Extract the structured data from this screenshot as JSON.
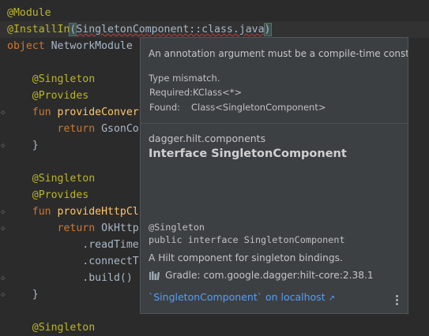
{
  "editor": {
    "lines": [
      {
        "segments": [
          {
            "text": "@Module",
            "cls": "ann"
          }
        ]
      },
      {
        "highlight": true,
        "segments": [
          {
            "text": "@InstallIn",
            "cls": "ann"
          },
          {
            "text": "(",
            "cls": "plain paren-match"
          },
          {
            "text": "SingletonComponent::class.java",
            "cls": "plain squiggle"
          },
          {
            "text": ")",
            "cls": "plain paren-match"
          }
        ]
      },
      {
        "segments": [
          {
            "text": "object ",
            "cls": "kw"
          },
          {
            "text": "NetworkModule",
            "cls": "plain"
          }
        ]
      },
      {
        "segments": []
      },
      {
        "segments": [
          {
            "text": "    @Singleton",
            "cls": "ann"
          }
        ]
      },
      {
        "segments": [
          {
            "text": "    @Provides",
            "cls": "ann"
          }
        ]
      },
      {
        "gutter": "fun",
        "segments": [
          {
            "text": "    fun ",
            "cls": "kw"
          },
          {
            "text": "provideConver",
            "cls": "fn"
          }
        ]
      },
      {
        "segments": [
          {
            "text": "        return ",
            "cls": "kw"
          },
          {
            "text": "GsonCo",
            "cls": "plain"
          }
        ]
      },
      {
        "gutter": "end",
        "segments": [
          {
            "text": "    }",
            "cls": "plain"
          }
        ]
      },
      {
        "segments": []
      },
      {
        "segments": [
          {
            "text": "    @Singleton",
            "cls": "ann"
          }
        ]
      },
      {
        "segments": [
          {
            "text": "    @Provides",
            "cls": "ann"
          }
        ]
      },
      {
        "gutter": "fun",
        "segments": [
          {
            "text": "    fun ",
            "cls": "kw"
          },
          {
            "text": "provideHttpCl",
            "cls": "fn"
          }
        ]
      },
      {
        "gutter": "fun",
        "segments": [
          {
            "text": "        return ",
            "cls": "kw"
          },
          {
            "text": "OkHttp",
            "cls": "plain"
          }
        ]
      },
      {
        "segments": [
          {
            "text": "            .readTime",
            "cls": "plain"
          }
        ]
      },
      {
        "segments": [
          {
            "text": "            .connectT",
            "cls": "plain"
          }
        ]
      },
      {
        "gutter": "end",
        "segments": [
          {
            "text": "            .build()",
            "cls": "plain"
          }
        ]
      },
      {
        "gutter": "end",
        "segments": [
          {
            "text": "    }",
            "cls": "plain"
          }
        ]
      },
      {
        "segments": []
      },
      {
        "segments": [
          {
            "text": "    @Singleton",
            "cls": "ann"
          }
        ]
      }
    ]
  },
  "popup": {
    "error_message": "An annotation argument must be a compile-time constant",
    "type_mismatch": "Type mismatch.",
    "required_label": "Required:",
    "required_value": "KClass<*>",
    "found_label": "Found:",
    "found_value": "Class<SingletonComponent>",
    "package": "dagger.hilt.components",
    "title": "Interface SingletonComponent",
    "signature_line1": "@Singleton",
    "signature_line2": "public interface SingletonComponent",
    "description": "A Hilt component for singleton bindings.",
    "gradle_text": "Gradle: com.google.dagger:hilt-core:2.38.1",
    "link_text": "`SingletonComponent` on localhost",
    "link_icon": "↗",
    "more_icon": "more-vertical-icon",
    "gradle_icon": "library-icon"
  },
  "colors": {
    "background": "#2b2b2b",
    "annotation": "#bbb529",
    "keyword": "#cc7832",
    "function": "#ffc66d",
    "text": "#a9b7c6",
    "error_underline": "#bc3f3c",
    "link": "#589df6",
    "popup_bg": "#3c3f41"
  }
}
